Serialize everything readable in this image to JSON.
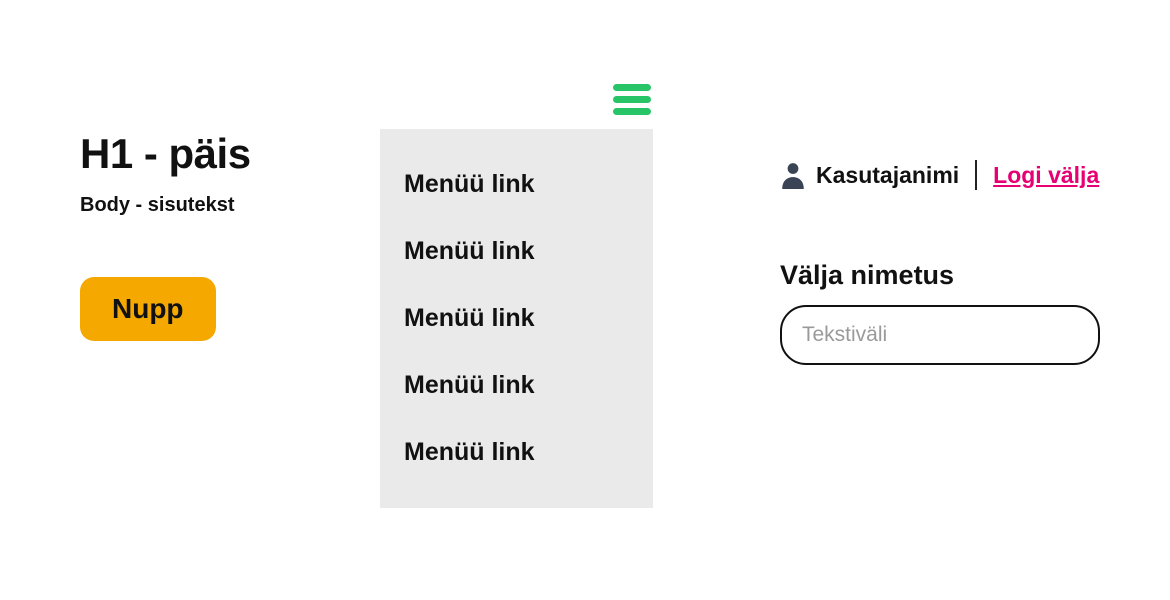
{
  "left": {
    "heading": "H1 - päis",
    "body": "Body - sisutekst",
    "button_label": "Nupp"
  },
  "menu": {
    "items": [
      {
        "label": "Menüü link"
      },
      {
        "label": "Menüü link"
      },
      {
        "label": "Menüü link"
      },
      {
        "label": "Menüü link"
      },
      {
        "label": "Menüü link"
      }
    ]
  },
  "user": {
    "name": "Kasutajanimi",
    "logout_label": "Logi välja"
  },
  "form": {
    "field_label": "Välja nimetus",
    "placeholder": "Tekstiväli"
  },
  "colors": {
    "button_bg": "#f4a800",
    "hamburger": "#27c468",
    "link": "#e60073"
  }
}
